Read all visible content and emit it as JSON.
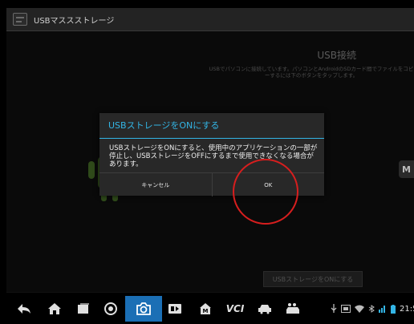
{
  "titlebar": {
    "title": "USBマススストレージ",
    "icon": "usb-storage-app-icon"
  },
  "background": {
    "heading": "USB接続",
    "description": "USBでパソコンに接続しています。パソコンとAndroidのSDカード間でファイルをコピーするには下のボタンをタップします。",
    "storage_button_label": "USBストレージをONにする",
    "side_badge": "M"
  },
  "dialog": {
    "title": "USBストレージをONにする",
    "message": "USBストレージをONにすると、使用中のアプリケーションの一部が停止し、USBストレージをOFFにするまで使用できなくなる場合があります。",
    "cancel_label": "キャンセル",
    "ok_label": "OK"
  },
  "navbar": {
    "items": [
      "back-icon",
      "home-icon",
      "recent-apps-icon",
      "browser-icon",
      "camera-icon",
      "screen-record-icon",
      "shop-icon",
      "vci-icon",
      "car-icon",
      "people-car-icon"
    ],
    "vci_label": "VCI",
    "clock": "21:5"
  },
  "colors": {
    "accent": "#33b5e5",
    "annotation": "#d71e1e",
    "camera_highlight": "#1b6fb5"
  }
}
